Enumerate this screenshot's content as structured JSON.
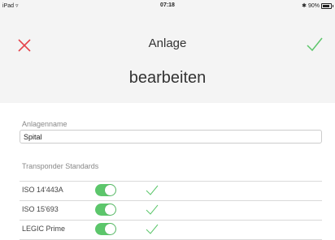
{
  "status_bar": {
    "device": "iPad",
    "wifi_icon": "wifi-icon",
    "time": "07:18",
    "bluetooth_icon": "bluetooth-icon",
    "battery_percent": "90%",
    "battery_level": 0.9
  },
  "header": {
    "title": "Anlage",
    "subtitle": "bearbeiten",
    "cancel_icon": "close-icon",
    "confirm_icon": "checkmark-icon",
    "cancel_color": "#e5444c",
    "confirm_color": "#5cc66b"
  },
  "form": {
    "name_label": "Anlagenname",
    "name_value": "Spital",
    "standards_label": "Transponder Standards",
    "standards": [
      {
        "label": "ISO 14'443A",
        "enabled": true,
        "supported": true
      },
      {
        "label": "ISO 15'693",
        "enabled": true,
        "supported": true
      },
      {
        "label": "LEGIC Prime",
        "enabled": true,
        "supported": true
      }
    ]
  },
  "colors": {
    "toggle_on": "#5cc66b",
    "header_bg": "#f4f4f4"
  }
}
